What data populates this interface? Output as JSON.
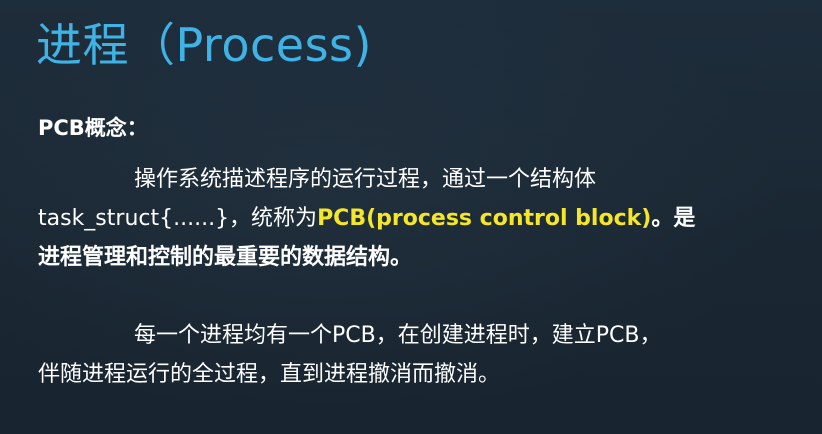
{
  "slide": {
    "title": "进程（Process)",
    "subtitle": "PCB概念：",
    "paragraph1": {
      "line1": "操作系统描述程序的运行过程，通过一个结构体",
      "line2_prefix": "task_struct{......}，统称为",
      "line2_highlight": "PCB(process control block)",
      "line2_suffix": "。是",
      "line3": "进程管理和控制的最重要的数据结构。"
    },
    "paragraph2": {
      "line1": "每一个进程均有一个PCB，在创建进程时，建立PCB，",
      "line2": "伴随进程运行的全过程，直到进程撤消而撤消。"
    }
  },
  "colors": {
    "background": "#1c2a37",
    "title": "#3fb3e6",
    "text": "#ffffff",
    "highlight": "#f5e627"
  }
}
